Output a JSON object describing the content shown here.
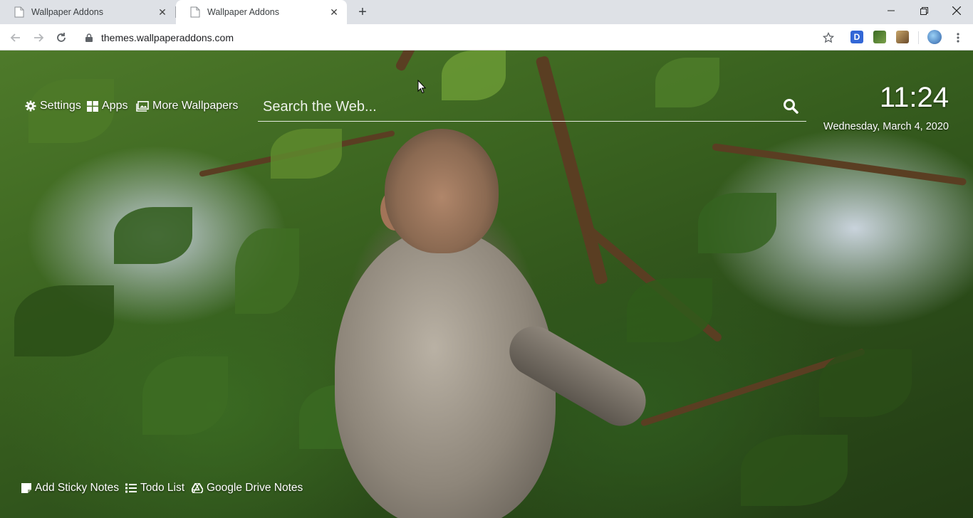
{
  "browser": {
    "tabs": [
      {
        "title": "Wallpaper Addons",
        "active": false
      },
      {
        "title": "Wallpaper Addons",
        "active": true
      }
    ],
    "new_tab_symbol": "+",
    "close_symbol": "✕",
    "url": "themes.wallpaperaddons.com",
    "extensions": [
      "D",
      "",
      ""
    ]
  },
  "page": {
    "nav": {
      "settings": "Settings",
      "apps": "Apps",
      "more_wallpapers": "More Wallpapers"
    },
    "search": {
      "placeholder": "Search the Web..."
    },
    "clock": {
      "time": "11:24",
      "date": "Wednesday, March 4, 2020"
    },
    "bottom": {
      "sticky_notes": "Add Sticky Notes",
      "todo_list": "Todo List",
      "drive_notes": "Google Drive Notes"
    },
    "icons": [
      "gear-icon",
      "windows-apps-icon",
      "image-icon",
      "search-icon",
      "sticky-note-icon",
      "list-icon",
      "google-drive-icon"
    ]
  },
  "colors": {
    "tabbar_bg": "#dee1e6",
    "overlay_text": "#ffffff",
    "extension_d": "#3367d6"
  }
}
